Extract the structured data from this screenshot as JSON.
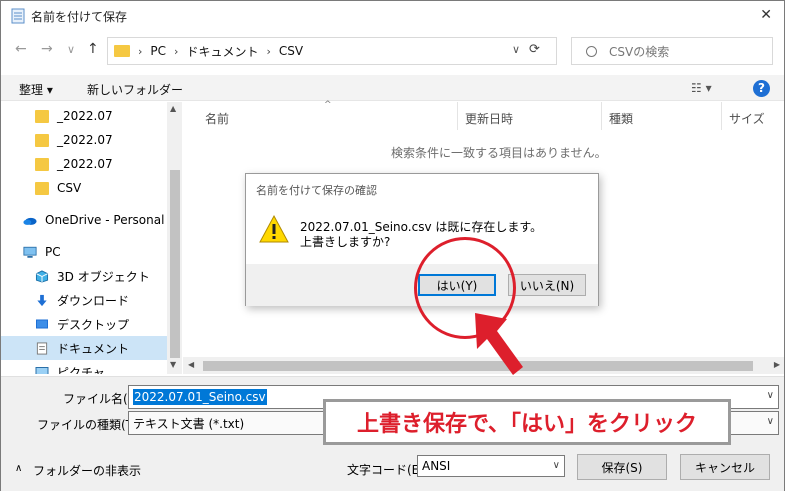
{
  "window": {
    "title": "名前を付けて保存",
    "close": "✕"
  },
  "nav": {
    "back": "←",
    "forward": "→",
    "up_history": "∨",
    "up": "↑",
    "refresh": "⟳"
  },
  "address": {
    "crumbs": [
      "PC",
      "ドキュメント",
      "CSV"
    ],
    "sep": "›",
    "dropdown": "∨"
  },
  "search": {
    "placeholder": "CSVの検索"
  },
  "toolbar": {
    "organize": "整理 ▾",
    "new_folder": "新しいフォルダー",
    "view": "☷ ▾",
    "help": "?"
  },
  "sidebar": {
    "items": [
      {
        "label": "_2022.07",
        "icon": "folder-icon"
      },
      {
        "label": "_2022.07",
        "icon": "folder-icon"
      },
      {
        "label": "_2022.07",
        "icon": "folder-icon"
      },
      {
        "label": "CSV",
        "icon": "folder-icon"
      },
      {
        "label": "OneDrive - Personal",
        "icon": "onedrive-icon"
      },
      {
        "label": "PC",
        "icon": "pc-icon"
      },
      {
        "label": "3D オブジェクト",
        "icon": "3d-objects-icon"
      },
      {
        "label": "ダウンロード",
        "icon": "download-icon"
      },
      {
        "label": "デスクトップ",
        "icon": "desktop-icon"
      },
      {
        "label": "ドキュメント",
        "icon": "documents-icon"
      },
      {
        "label": "ピクチャ",
        "icon": "pictures-icon"
      }
    ]
  },
  "columns": {
    "name": "名前",
    "modified": "更新日時",
    "type": "種類",
    "size": "サイズ"
  },
  "list": {
    "empty": "検索条件に一致する項目はありません。"
  },
  "form": {
    "filename_label": "ファイル名(N):",
    "filename_value": "2022.07.01_Seino.csv",
    "filetype_label": "ファイルの種類(T):",
    "filetype_value": "テキスト文書 (*.txt)",
    "encoding_label": "文字コード(E):",
    "encoding_value": "ANSI",
    "hide_folders": "フォルダーの非表示",
    "save": "保存(S)",
    "cancel": "キャンセル"
  },
  "dialog": {
    "title": "名前を付けて保存の確認",
    "line1": "2022.07.01_Seino.csv は既に存在します。",
    "line2": "上書きしますか?",
    "yes": "はい(Y)",
    "no": "いいえ(N)"
  },
  "annotation": {
    "text": "上書き保存で、「はい」をクリック",
    "color": "#dd1f2c"
  }
}
